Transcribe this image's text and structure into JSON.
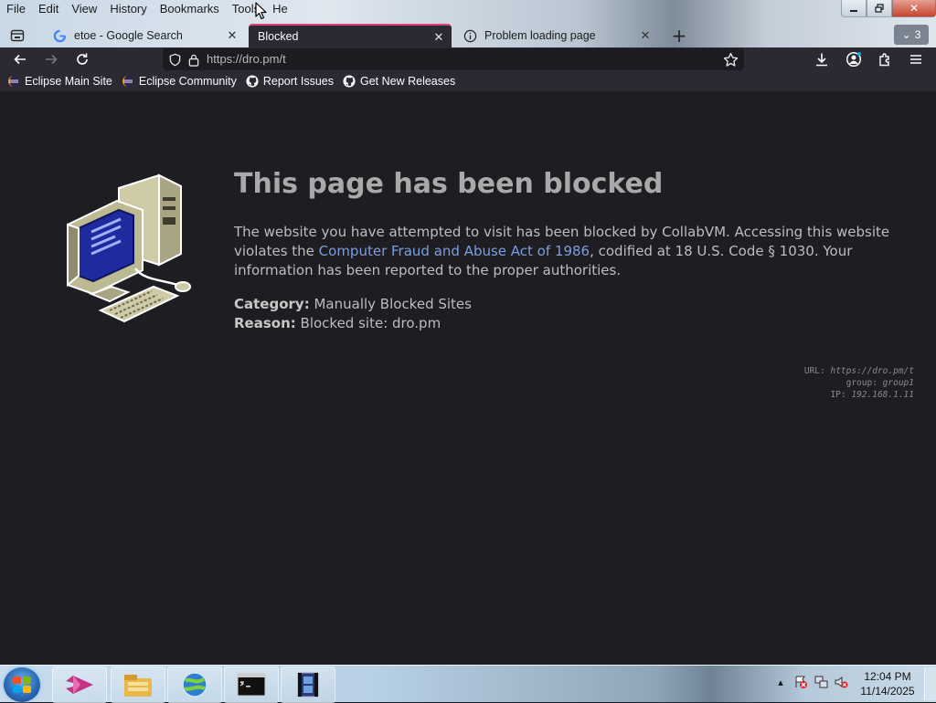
{
  "menubar": {
    "items": [
      {
        "label": "File"
      },
      {
        "label": "Edit"
      },
      {
        "label": "View"
      },
      {
        "label": "History"
      },
      {
        "label": "Bookmarks"
      },
      {
        "label": "Tools"
      },
      {
        "label": "He"
      }
    ]
  },
  "tabs": [
    {
      "title": "etoe - Google Search",
      "icon": "google-icon",
      "active": false
    },
    {
      "title": "Blocked",
      "icon": "none",
      "active": true
    },
    {
      "title": "Problem loading page",
      "icon": "info-icon",
      "active": false
    }
  ],
  "all_tabs_count": "3",
  "navbar": {
    "url": "https://dro.pm/t"
  },
  "bookmarks": [
    {
      "label": "Eclipse Main Site",
      "icon": "eclipse-icon"
    },
    {
      "label": "Eclipse Community",
      "icon": "eclipse-icon"
    },
    {
      "label": "Report Issues",
      "icon": "github-icon"
    },
    {
      "label": "Get New Releases",
      "icon": "github-icon"
    }
  ],
  "page": {
    "title": "This page has been blocked",
    "paragraph_before": "The website you have attempted to visit has been blocked by CollabVM. Accessing this website violates the ",
    "link_text": "Computer Fraud and Abuse Act of 1986",
    "paragraph_after": ", codified at 18 U.S. Code § 1030. Your information has been reported to the proper authorities.",
    "category_label": "Category:",
    "category_value": "Manually Blocked Sites",
    "reason_label": "Reason:",
    "reason_value": "Blocked site: dro.pm",
    "debug": {
      "url_label": "URL:",
      "url_value": "https://dro.pm/t",
      "group_label": "group:",
      "group_value": "group1",
      "ip_label": "IP:",
      "ip_value": "192.168.1.11"
    }
  },
  "taskbar": {
    "apps": [
      {
        "name": "visual-studio-icon"
      },
      {
        "name": "file-explorer-icon"
      },
      {
        "name": "browser-globe-icon"
      },
      {
        "name": "command-prompt-icon"
      },
      {
        "name": "media-player-icon"
      }
    ],
    "clock_time": "12:04 PM",
    "clock_date": "11/14/2025"
  },
  "colors": {
    "accent_tab": "#e0437a",
    "link": "#7b9ee0",
    "page_bg": "#1e1d21",
    "toolbar_bg": "#2b2a33"
  }
}
